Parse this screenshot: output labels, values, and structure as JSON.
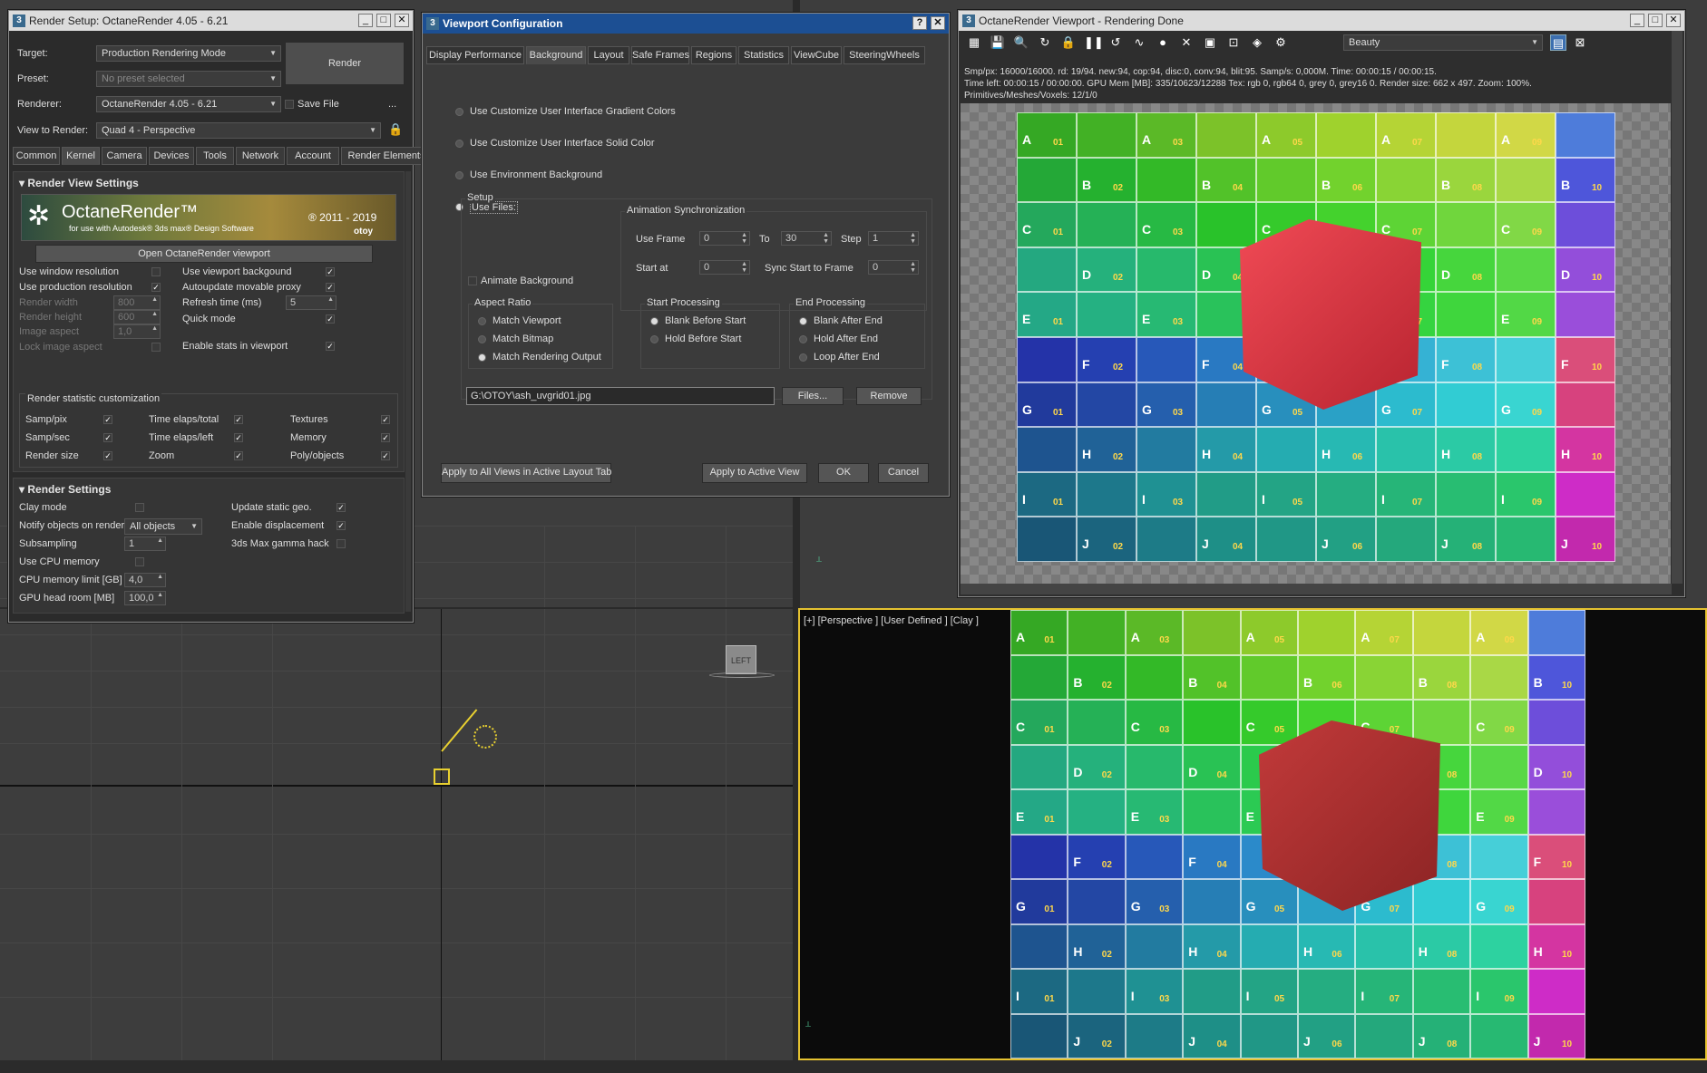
{
  "render_setup": {
    "title": "Render Setup: OctaneRender 4.05 - 6.21",
    "target_label": "Target:",
    "target_value": "Production Rendering Mode",
    "preset_label": "Preset:",
    "preset_value": "No preset selected",
    "renderer_label": "Renderer:",
    "renderer_value": "OctaneRender 4.05 - 6.21",
    "save_file": "Save File",
    "more": "...",
    "view_label": "View to Render:",
    "view_value": "Quad 4 - Perspective",
    "render_button": "Render",
    "tabs": [
      "Common",
      "Kernel",
      "Camera",
      "Devices",
      "Tools",
      "Network",
      "Account",
      "Render Elements"
    ],
    "selected_tab": "Kernel",
    "view_settings_title": "Render View Settings",
    "banner_title": "OctaneRender™",
    "banner_sub": "for use with Autodesk® 3ds max® Design Software",
    "banner_years": "® 2011 - 2019",
    "banner_brand": "otoy",
    "open_viewport": "Open OctaneRender viewport",
    "left_opts": [
      {
        "label": "Use window resolution",
        "checked": false,
        "dim": false
      },
      {
        "label": "Use production resolution",
        "checked": true,
        "dim": false
      },
      {
        "label": "Render width",
        "value": "800",
        "dim": true
      },
      {
        "label": "Render height",
        "value": "600",
        "dim": true
      },
      {
        "label": "Image aspect",
        "value": "1,0",
        "dim": true
      },
      {
        "label": "Lock image aspect",
        "checked": false,
        "dim": true
      }
    ],
    "right_opts": [
      {
        "label": "Use viewport backgound",
        "checked": true
      },
      {
        "label": "Autoupdate movable proxy",
        "checked": true
      },
      {
        "label": "Refresh time (ms)",
        "value": "5"
      },
      {
        "label": "Quick mode",
        "checked": true
      },
      {
        "label": "Enable stats in viewport",
        "checked": true
      }
    ],
    "stat_title": "Render statistic customization",
    "stats": [
      [
        "Samp/pix",
        "Time elaps/total",
        "Textures"
      ],
      [
        "Samp/sec",
        "Time elaps/left",
        "Memory"
      ],
      [
        "Render size",
        "Zoom",
        "Poly/objects"
      ]
    ],
    "render_settings_title": "Render Settings",
    "rs_left": [
      {
        "label": "Clay mode"
      },
      {
        "label": "Notify objects on render",
        "combo": "All objects"
      },
      {
        "label": "Subsampling",
        "value": "1"
      },
      {
        "label": "Use CPU memory"
      },
      {
        "label": "CPU memory limit [GB]",
        "value": "4,0"
      },
      {
        "label": "GPU head room [MB]",
        "value": "100,0"
      }
    ],
    "rs_right": [
      {
        "label": "Update static geo.",
        "checked": true
      },
      {
        "label": "Enable displacement",
        "checked": true
      },
      {
        "label": "3ds Max gamma hack",
        "checked": false
      }
    ]
  },
  "viewport_config": {
    "title": "Viewport Configuration",
    "tabs": [
      "Display Performance",
      "Background",
      "Layout",
      "Safe Frames",
      "Regions",
      "Statistics",
      "ViewCube",
      "SteeringWheels"
    ],
    "selected_tab": "Background",
    "options": [
      "Use Customize User Interface Gradient Colors",
      "Use Customize User Interface Solid Color",
      "Use Environment Background",
      "Use Files:"
    ],
    "setup": "Setup",
    "anim_sync": "Animation Synchronization",
    "use_frame": "Use Frame",
    "use_frame_val": "0",
    "to": "To",
    "to_val": "30",
    "step": "Step",
    "step_val": "1",
    "start_at": "Start at",
    "start_at_val": "0",
    "sync_start": "Sync Start to Frame",
    "sync_start_val": "0",
    "animate_bg": "Animate Background",
    "aspect_ratio": "Aspect Ratio",
    "aspect_opts": [
      "Match Viewport",
      "Match Bitmap",
      "Match Rendering Output"
    ],
    "start_processing": "Start Processing",
    "start_opts": [
      "Blank Before Start",
      "Hold Before Start"
    ],
    "end_processing": "End Processing",
    "end_opts": [
      "Blank After End",
      "Hold After End",
      "Loop After End"
    ],
    "file_path": "G:\\OTOY\\ash_uvgrid01.jpg",
    "files_btn": "Files...",
    "remove_btn": "Remove",
    "apply_all": "Apply to All Views in Active Layout Tab",
    "apply_active": "Apply to Active View",
    "ok": "OK",
    "cancel": "Cancel"
  },
  "octane_viewport": {
    "title": "OctaneRender Viewport - Rendering Done",
    "beauty": "Beauty",
    "stats_line1": "Smp/px: 16000/16000.   rd: 19/94.   new:94, cop:94, disc:0, conv:94, blit:95.   Samp/s: 0,000M.   Time: 00:00:15 / 00:00:15.",
    "stats_line2": "Time left: 00:00:15 / 00:00:00.   GPU Mem [MB]: 335/10623/12288   Tex: rgb 0, rgb64 0, grey 0, grey16 0.   Render size: 662 x 497.   Zoom: 100%.",
    "stats_line3": "Primitives/Meshes/Voxels: 12/1/0"
  },
  "perspective_viewport": {
    "label": "[+] [Perspective ] [User Defined ] [Clay ]"
  },
  "viewcube_label": "LEFT",
  "uvgrid": {
    "rows": [
      "A",
      "B",
      "C",
      "D",
      "E",
      "F",
      "G",
      "H",
      "I",
      "J"
    ],
    "numbers": [
      "01",
      "02",
      "03",
      "04",
      "05",
      "06",
      "07",
      "08",
      "09",
      "10"
    ]
  },
  "colors": {
    "title_active": "#1c4f93",
    "cube": "#d8323c",
    "accent": "#ffd84a"
  }
}
